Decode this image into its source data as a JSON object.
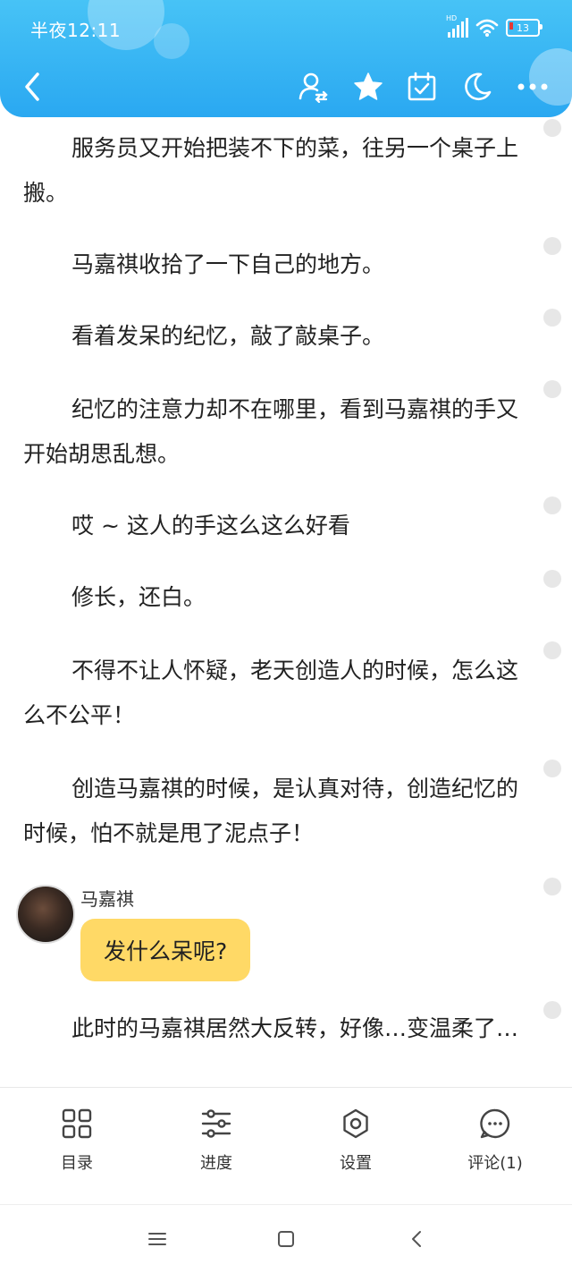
{
  "status_bar": {
    "time": "半夜12:11",
    "network": "HD",
    "battery": "13"
  },
  "header": {
    "icons": [
      "back-icon",
      "user-switch-icon",
      "star-icon",
      "calendar-check-icon",
      "moon-icon",
      "more-icon"
    ]
  },
  "content": {
    "paragraphs": [
      "服务员又开始把装不下的菜，往另一个桌子上搬。",
      "马嘉祺收拾了一下自己的地方。",
      "看着发呆的纪忆，敲了敲桌子。",
      "纪忆的注意力却不在哪里，看到马嘉祺的手又开始胡思乱想。",
      "哎 ~ 这人的手这么这么好看",
      "修长，还白。",
      "不得不让人怀疑，老天创造人的时候，怎么这么不公平！",
      "创造马嘉祺的时候，是认真对待，创造纪忆的时候，怕不就是甩了泥点子！"
    ],
    "dialogue": {
      "speaker": "马嘉祺",
      "message": "发什么呆呢?",
      "bubble_color": "#ffd966"
    },
    "after_dialogue": "此时的马嘉祺居然大反转，好像…变温柔了…"
  },
  "toolbar": {
    "items": [
      {
        "label": "目录",
        "icon": "grid-icon"
      },
      {
        "label": "进度",
        "icon": "sliders-icon"
      },
      {
        "label": "设置",
        "icon": "gear-icon"
      },
      {
        "label": "评论(1)",
        "icon": "comment-icon"
      }
    ]
  },
  "colors": {
    "header_top": "#47c3f6",
    "header_bottom": "#2aa8f1",
    "accent_bubble": "#ffd966"
  }
}
